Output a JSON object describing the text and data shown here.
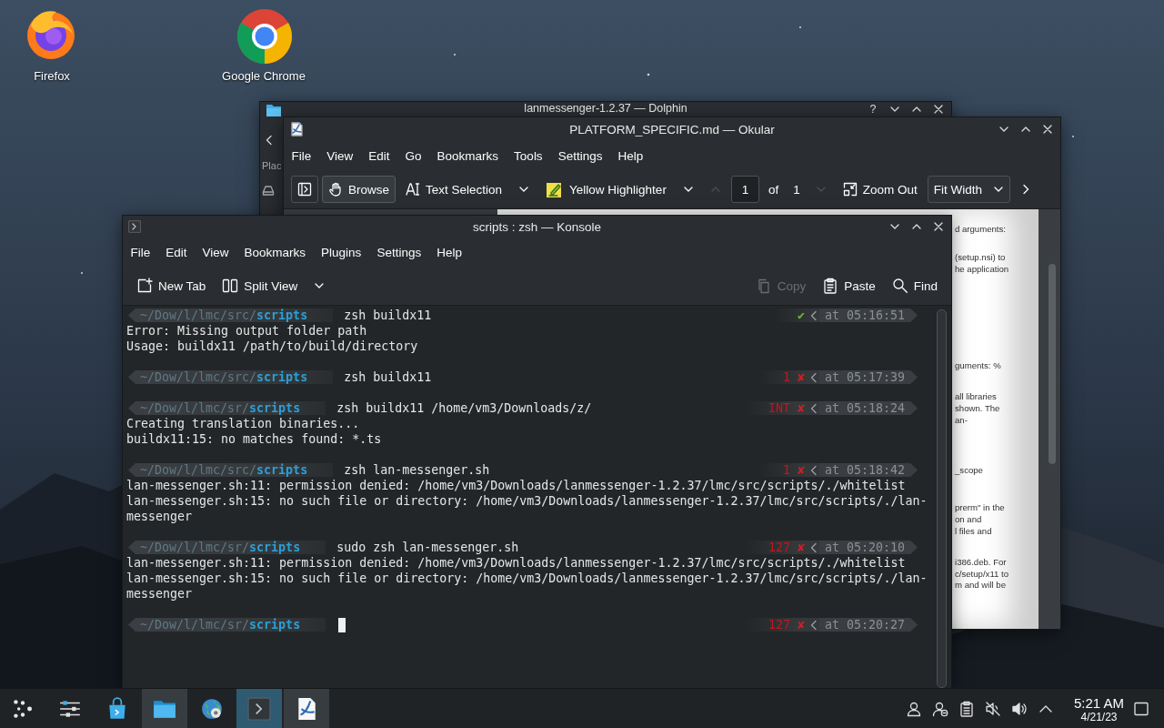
{
  "desktop": {
    "icons": [
      {
        "label": "Firefox",
        "kind": "firefox"
      },
      {
        "label": "Google Chrome",
        "kind": "chrome"
      }
    ]
  },
  "dolphin": {
    "title": "lanmessenger-1.2.37 — Dolphin",
    "help": "?",
    "sidebar_label": "Plac"
  },
  "okular": {
    "title": "PLATFORM_SPECIFIC.md — Okular",
    "menu": [
      "File",
      "View",
      "Edit",
      "Go",
      "Bookmarks",
      "Tools",
      "Settings",
      "Help"
    ],
    "tools": [
      {
        "label": "Browse",
        "kind": "hand",
        "selected": true
      },
      {
        "label": "Text Selection",
        "kind": "text-select",
        "selected": false
      },
      {
        "label": "Yellow Highlighter",
        "kind": "highlighter",
        "selected": false
      }
    ],
    "page_nav": {
      "page": "1",
      "of": "of",
      "total": "1"
    },
    "zoom_out": "Zoom Out",
    "zoom_mode": "Fit Width",
    "page_paragraphs": [
      [
        "d arguments:"
      ],
      [
        "(setup.nsi) to",
        "he application"
      ],
      [
        "guments: %"
      ],
      [
        "all libraries",
        "shown. The",
        "an-"
      ],
      [
        "_scope"
      ],
      [
        "prerm\" in the",
        "on and",
        "l files and"
      ],
      [
        "i386.deb. For",
        "c/setup/x11 to",
        "m and will be"
      ]
    ]
  },
  "konsole": {
    "title": "scripts : zsh — Konsole",
    "menu": [
      "File",
      "Edit",
      "View",
      "Bookmarks",
      "Plugins",
      "Settings",
      "Help"
    ],
    "toolbar_left": [
      {
        "label": "New Tab",
        "kind": "new-tab"
      },
      {
        "label": "Split View",
        "kind": "split"
      }
    ],
    "toolbar_right": [
      {
        "label": "Copy",
        "kind": "copy",
        "disabled": true
      },
      {
        "label": "Paste",
        "kind": "paste",
        "disabled": false
      },
      {
        "label": "Find",
        "kind": "find",
        "disabled": false
      }
    ],
    "blocks": [
      {
        "path": "~/Dow/l/lmc/src/",
        "dir": "scripts",
        "command": "zsh buildx11",
        "status": {
          "ok": true,
          "mark": "✔",
          "time": "at 05:16:51"
        },
        "output": [
          "Error: Missing output folder path",
          "Usage: buildx11 /path/to/build/directory"
        ]
      },
      {
        "path": "~/Dow/l/lmc/src/",
        "dir": "scripts",
        "command": "zsh buildx11",
        "status": {
          "ok": false,
          "code": "1",
          "mark": "✘",
          "time": "at 05:17:39"
        }
      },
      {
        "path": "~/Dow/l/lmc/sr/",
        "dir": "scripts",
        "command": "zsh buildx11 /home/vm3/Downloads/z/",
        "status": {
          "ok": false,
          "code": "INT",
          "mark": "✘",
          "time": "at 05:18:24"
        },
        "output": [
          "Creating translation binaries...",
          "buildx11:15: no matches found: *.ts"
        ]
      },
      {
        "path": "~/Dow/l/lmc/src/",
        "dir": "scripts",
        "command": "zsh lan-messenger.sh",
        "status": {
          "ok": false,
          "code": "1",
          "mark": "✘",
          "time": "at 05:18:42"
        },
        "output": [
          "lan-messenger.sh:11: permission denied: /home/vm3/Downloads/lanmessenger-1.2.37/lmc/src/scripts/./whitelist",
          "lan-messenger.sh:15: no such file or directory: /home/vm3/Downloads/lanmessenger-1.2.37/lmc/src/scripts/./lan-messenger"
        ]
      },
      {
        "path": "~/Dow/l/lmc/sr/",
        "dir": "scripts",
        "command": "sudo zsh lan-messenger.sh",
        "status": {
          "ok": false,
          "code": "127",
          "mark": "✘",
          "time": "at 05:20:10"
        },
        "output": [
          "lan-messenger.sh:11: permission denied: /home/vm3/Downloads/lanmessenger-1.2.37/lmc/src/scripts/./whitelist",
          "lan-messenger.sh:15: no such file or directory: /home/vm3/Downloads/lanmessenger-1.2.37/lmc/src/scripts/./lan-messenger"
        ]
      },
      {
        "path": "~/Dow/l/lmc/sr/",
        "dir": "scripts",
        "cursor": true,
        "status": {
          "ok": false,
          "code": "127",
          "mark": "✘",
          "time": "at 05:20:27"
        }
      }
    ]
  },
  "taskbar": {
    "tasks": [
      {
        "kind": "launcher",
        "open": false,
        "active": false
      },
      {
        "kind": "sliders",
        "open": false,
        "active": false
      },
      {
        "kind": "store",
        "open": false,
        "active": false
      },
      {
        "kind": "folder",
        "open": true,
        "active": false
      },
      {
        "kind": "globe",
        "open": false,
        "active": false
      },
      {
        "kind": "terminal",
        "open": true,
        "active": true
      },
      {
        "kind": "document",
        "open": true,
        "active": false
      }
    ],
    "tray": [
      {
        "kind": "user"
      },
      {
        "kind": "user-minus"
      },
      {
        "kind": "clipboard"
      },
      {
        "kind": "muted"
      },
      {
        "kind": "volume"
      },
      {
        "kind": "expand"
      }
    ],
    "clock": {
      "time": "5:21 AM",
      "date": "4/21/23"
    }
  }
}
